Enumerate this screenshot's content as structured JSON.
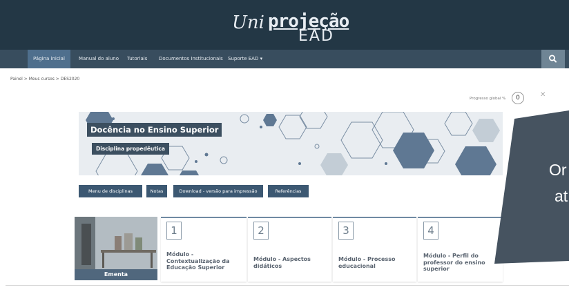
{
  "header": {
    "logo_uni": "Uni",
    "logo_projecao": "projeção",
    "logo_ead": "EAD"
  },
  "nav": {
    "items": [
      {
        "label": "Página inicial"
      },
      {
        "label": "Manual do aluno"
      },
      {
        "label": "Tutoriais"
      },
      {
        "label": "Documentos Institucionais"
      },
      {
        "label": "Suporte EAD ▾"
      }
    ]
  },
  "breadcrumb": "Painel  >  Meus cursos  >  DES2020",
  "progress": {
    "label": "Progresso global %",
    "value": "0"
  },
  "banner": {
    "title": "Docência no Ensino Superior",
    "subtitle": "Disciplina propedêutica"
  },
  "menu_buttons": [
    {
      "label": "Menu de disciplinas"
    },
    {
      "label": "Notas"
    },
    {
      "label": "Download - versão para impressão"
    },
    {
      "label": "Referências"
    }
  ],
  "ementa": {
    "label": "Ementa"
  },
  "modules": [
    {
      "num": "1",
      "title_lines": [
        "Módulo -",
        "Contextualização da",
        "Educação Superior"
      ]
    },
    {
      "num": "2",
      "title_lines": [
        "Módulo - Aspectos",
        "didáticos"
      ]
    },
    {
      "num": "3",
      "title_lines": [
        "Módulo - Processo",
        "educacional"
      ]
    },
    {
      "num": "4",
      "title_lines": [
        "Módulo - Perfil do",
        "professor do ensino",
        "superior"
      ]
    }
  ],
  "overlay": {
    "line1": "Or",
    "line2": "at"
  },
  "colors": {
    "header": "#233745",
    "navbar": "#384d5e",
    "accent": "#3c5872",
    "overlay": "#3e4c59"
  }
}
